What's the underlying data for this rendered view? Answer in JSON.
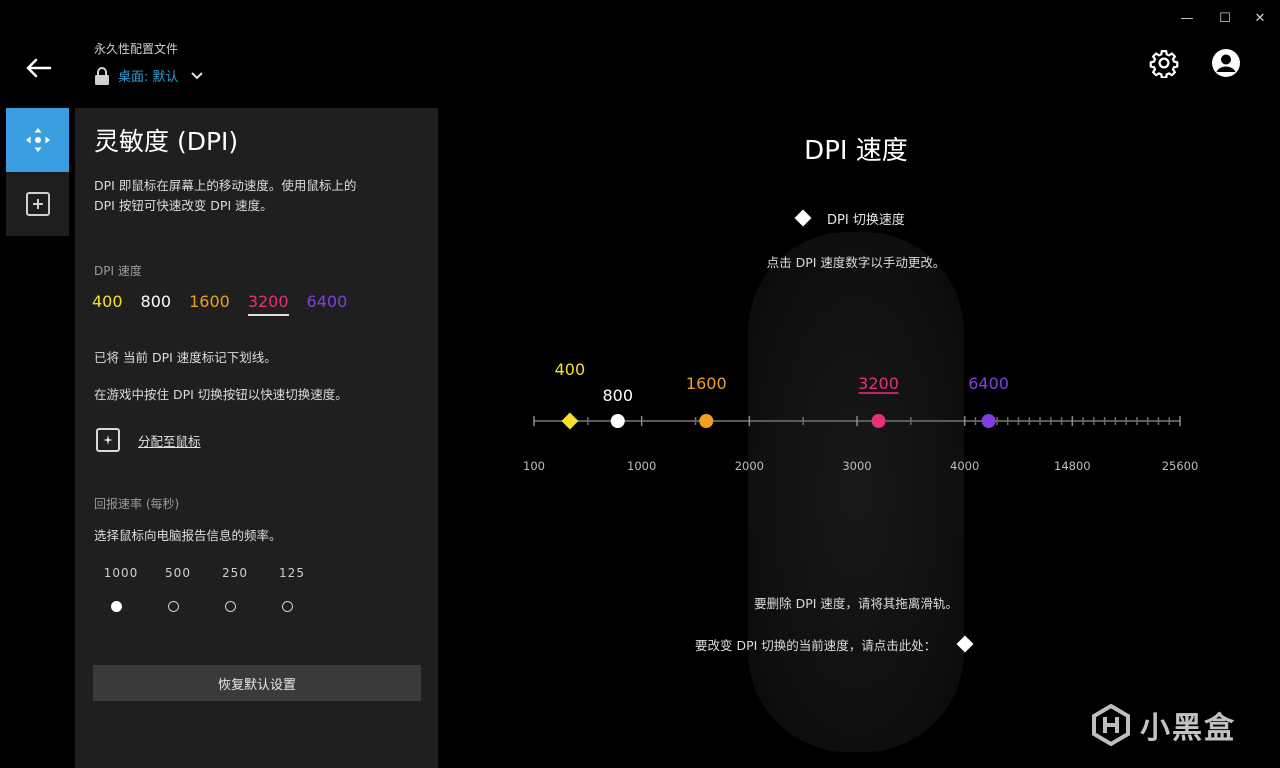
{
  "window": {
    "minimize": "—",
    "maximize": "☐",
    "close": "✕"
  },
  "header": {
    "profile_caption": "永久性配置文件",
    "profile_name": "桌面: 默认"
  },
  "sidebar": {
    "items": [
      {
        "icon": "move-arrows-icon",
        "active": true
      },
      {
        "icon": "add-square-icon",
        "active": false
      }
    ]
  },
  "panel": {
    "title": "灵敏度 (DPI)",
    "description_1": "DPI 即鼠标在屏幕上的移动速度。使用鼠标上的",
    "description_2": "DPI 按钮可快速改变 DPI 速度。",
    "dpi_label": "DPI 速度",
    "dpi_values": [
      {
        "value": "400",
        "color": "#f5e030"
      },
      {
        "value": "800",
        "color": "#ffffff"
      },
      {
        "value": "1600",
        "color": "#f0a020"
      },
      {
        "value": "3200",
        "color": "#e8307a",
        "current": true
      },
      {
        "value": "6400",
        "color": "#8040e0"
      }
    ],
    "note_1": "已将 当前 DPI 速度标记下划线。",
    "note_2": "在游戏中按住 DPI 切换按钮以快速切换速度。",
    "assign_label": "分配至鼠标",
    "report_label": "回报速率 (每秒)",
    "report_desc": "选择鼠标向电脑报告信息的频率。",
    "report_rates": [
      {
        "label": "1000",
        "selected": true
      },
      {
        "label": "500",
        "selected": false
      },
      {
        "label": "250",
        "selected": false
      },
      {
        "label": "125",
        "selected": false
      }
    ],
    "reset_label": "恢复默认设置"
  },
  "main": {
    "title": "DPI 速度",
    "legend": "DPI 切换速度",
    "hint_top": "点击 DPI 速度数字以手动更改。",
    "hint_remove": "要删除 DPI 速度，请将其拖离滑轨。",
    "hint_shift": "要改变 DPI 切换的当前速度，请点击此处："
  },
  "watermark": {
    "text": "小黑盒"
  },
  "chart_data": {
    "type": "slider",
    "axis_ticks": [
      "100",
      "1000",
      "2000",
      "3000",
      "4000",
      "14800",
      "25600"
    ],
    "markers": [
      {
        "label": "400",
        "value": 400,
        "color": "#f5e030",
        "shape": "diamond"
      },
      {
        "label": "800",
        "value": 800,
        "color": "#ffffff",
        "shape": "circle"
      },
      {
        "label": "1600",
        "value": 1600,
        "color": "#f0a020",
        "shape": "circle"
      },
      {
        "label": "3200",
        "value": 3200,
        "color": "#e8307a",
        "shape": "circle",
        "current": true
      },
      {
        "label": "6400",
        "value": 6400,
        "color": "#8040e0",
        "shape": "circle"
      }
    ]
  }
}
